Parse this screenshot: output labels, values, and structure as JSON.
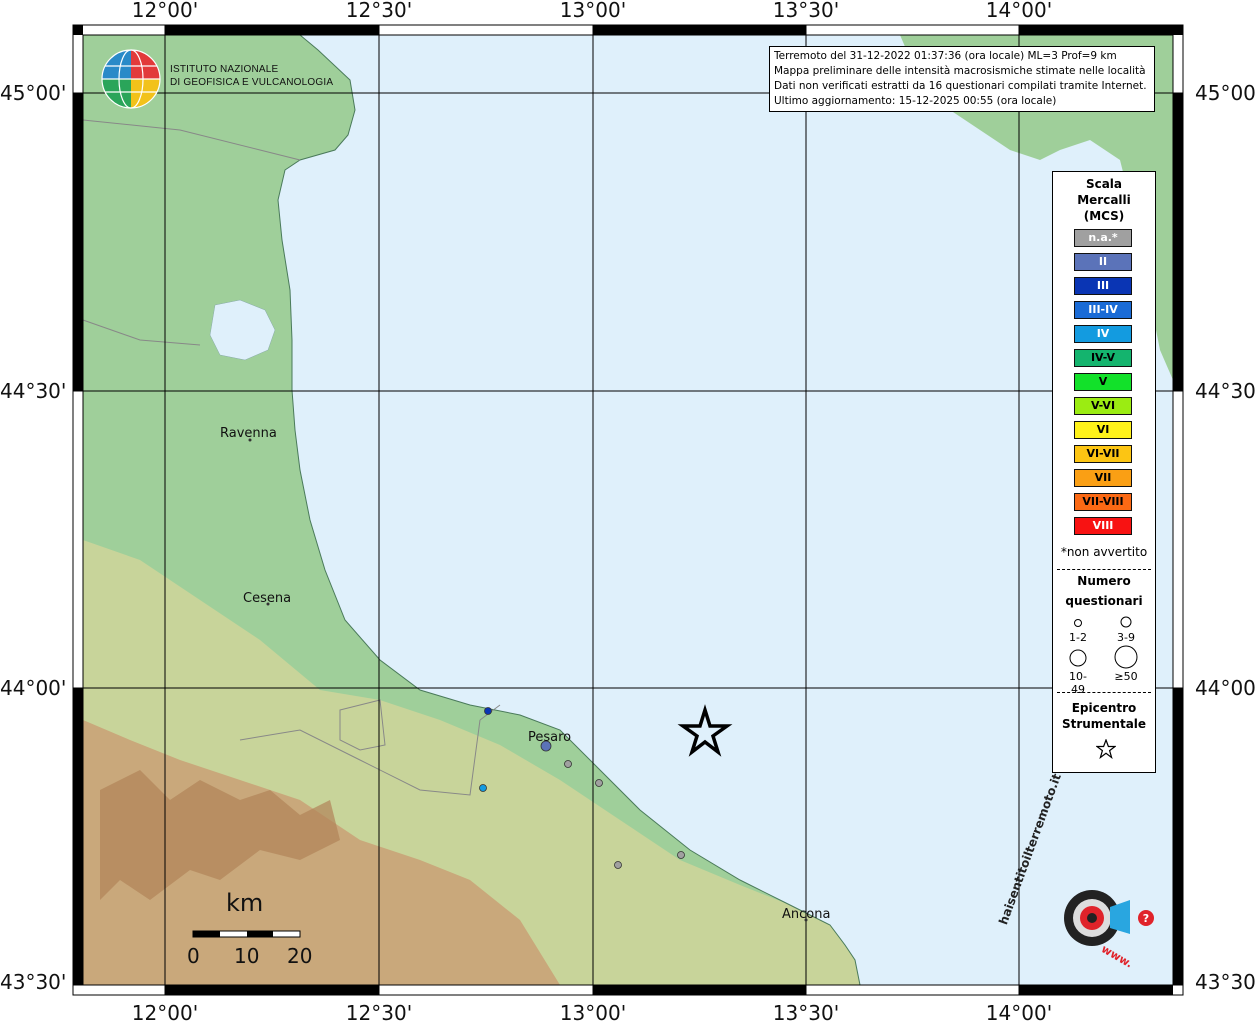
{
  "axes": {
    "lon_labels": [
      "12°00'",
      "12°30'",
      "13°00'",
      "13°30'",
      "14°00'"
    ],
    "lat_labels": [
      "45°00'",
      "44°30'",
      "44°00'",
      "43°30'"
    ]
  },
  "logo": {
    "line1": "ISTITUTO NAZIONALE",
    "line2": "DI GEOFISICA E VULCANOLOGIA"
  },
  "info": {
    "line1": "Terremoto del 31-12-2022 01:37:36 (ora locale) ML=3 Prof=9 km",
    "line2": "Mappa preliminare delle intensità macrosismiche stimate nelle località",
    "line3": "Dati non verificati estratti da 16 questionari compilati tramite Internet.",
    "line4": "Ultimo aggiornamento: 15-12-2025 00:55 (ora locale)"
  },
  "legend": {
    "title1": "Scala",
    "title2": "Mercalli",
    "title3": "(MCS)",
    "scale": [
      {
        "label": "n.a.*",
        "color": "#a0a0a0",
        "text_color": "#ffffff"
      },
      {
        "label": "II",
        "color": "#5b73b9",
        "text_color": "#ffffff"
      },
      {
        "label": "III",
        "color": "#0a35b4",
        "text_color": "#ffffff"
      },
      {
        "label": "III-IV",
        "color": "#1a6bd6",
        "text_color": "#ffffff"
      },
      {
        "label": "IV",
        "color": "#139be0",
        "text_color": "#ffffff"
      },
      {
        "label": "IV-V",
        "color": "#14b46e",
        "text_color": "#000000"
      },
      {
        "label": "V",
        "color": "#12e12a",
        "text_color": "#000000"
      },
      {
        "label": "V-VI",
        "color": "#9bec12",
        "text_color": "#000000"
      },
      {
        "label": "VI",
        "color": "#fff21a",
        "text_color": "#000000"
      },
      {
        "label": "VI-VII",
        "color": "#fcc513",
        "text_color": "#000000"
      },
      {
        "label": "VII",
        "color": "#fa9f14",
        "text_color": "#000000"
      },
      {
        "label": "VII-VIII",
        "color": "#fb6914",
        "text_color": "#000000"
      },
      {
        "label": "VIII",
        "color": "#f81212",
        "text_color": "#ffffff"
      }
    ],
    "note": "*non avvertito",
    "count_title1": "Numero",
    "count_title2": "questionari",
    "sizes": [
      "1-2",
      "3-9",
      "10-49",
      "≥50"
    ],
    "epicenter1": "Epicentro",
    "epicenter2": "Strumentale"
  },
  "places": [
    {
      "name": "Ravenna"
    },
    {
      "name": "Cesena"
    },
    {
      "name": "Pesaro"
    },
    {
      "name": "Ancona"
    }
  ],
  "reports": [
    {
      "intensity": "III",
      "color": "#0a35b4"
    },
    {
      "intensity": "II",
      "color": "#5b73b9"
    },
    {
      "intensity": "n.a.*",
      "color": "#a0a0a0"
    },
    {
      "intensity": "n.a.*",
      "color": "#a0a0a0"
    },
    {
      "intensity": "IV",
      "color": "#139be0"
    },
    {
      "intensity": "n.a.*",
      "color": "#a0a0a0"
    },
    {
      "intensity": "n.a.*",
      "color": "#a0a0a0"
    }
  ],
  "scalebar": {
    "unit": "km",
    "labels": [
      "0",
      "10",
      "20"
    ]
  },
  "brand": {
    "text": "haisentitoilterremoto.it",
    "url": "www."
  },
  "colors": {
    "sea": "#dff0fb",
    "land_low": "#9fcf9a",
    "land_hill": "#c8d49a",
    "land_mountain": "#c9a075"
  }
}
